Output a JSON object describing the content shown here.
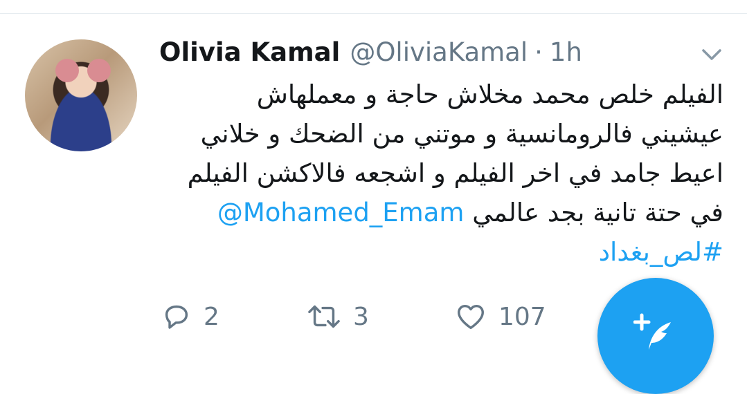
{
  "tweet": {
    "author_name": "Olivia Kamal",
    "handle": "@OliviaKamal",
    "separator": "·",
    "time": "1h",
    "text_lines": [
      "الفيلم خلص محمد مخلاش حاجة و معملهاش",
      "عيشيني فالرومانسية و موتني من الضحك و خلاني",
      "اعيط  جامد في اخر الفيلم و اشجعه فالاكشن الفيلم"
    ],
    "line4_text": "في حتة تانية بجد عالمي",
    "mention": "@Mohamed_Emam",
    "hashtag": "#لص_بغداد"
  },
  "actions": {
    "reply_count": "2",
    "retweet_count": "3",
    "like_count": "107"
  },
  "icons": {
    "more": "chevron-down-icon",
    "reply": "reply-icon",
    "retweet": "retweet-icon",
    "like": "heart-icon",
    "compose": "compose-tweet-icon"
  },
  "colors": {
    "accent": "#1da1f2",
    "secondary_text": "#657786",
    "primary_text": "#14171a"
  }
}
